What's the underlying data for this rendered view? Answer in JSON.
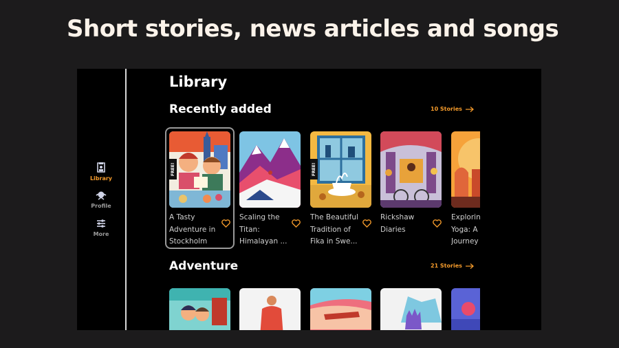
{
  "headline": "Short stories, news articles and songs",
  "nav": [
    {
      "label": "Library",
      "icon": "library-icon",
      "active": true
    },
    {
      "label": "Profile",
      "icon": "profile-icon",
      "active": false
    },
    {
      "label": "More",
      "icon": "sliders-icon",
      "active": false
    }
  ],
  "page_title": "Library",
  "sections": [
    {
      "title": "Recently added",
      "see_all": "10 Stories",
      "cards": [
        {
          "title": "A Tasty Adventure in Stockholm",
          "badge": "FREE!"
        },
        {
          "title": "Scaling the Titan: Himalayan ...",
          "badge": ""
        },
        {
          "title": "The Beautiful Tradition of Fika in Swe...",
          "badge": "FREE!"
        },
        {
          "title": "Rickshaw Diaries",
          "badge": ""
        },
        {
          "title": "Exploring Yoga: A Journey",
          "badge": ""
        }
      ]
    },
    {
      "title": "Adventure",
      "see_all": "21 Stories",
      "cards": []
    }
  ],
  "colors": {
    "accent": "#f39a2b",
    "background": "#000000",
    "page_bg": "#1c1b1c"
  }
}
